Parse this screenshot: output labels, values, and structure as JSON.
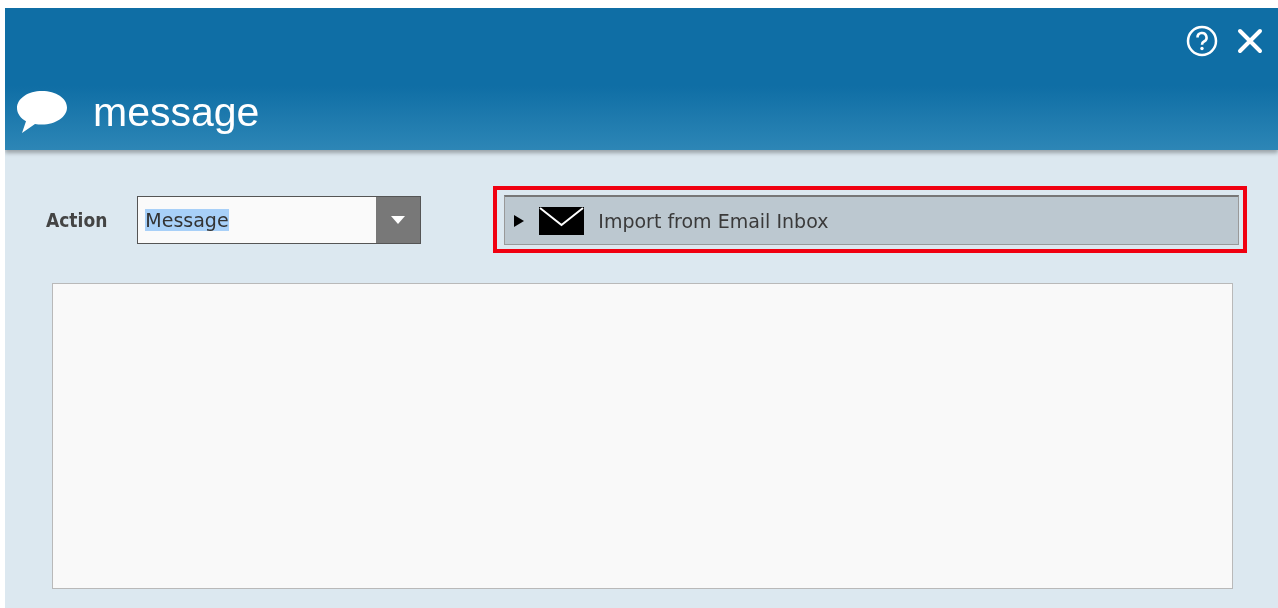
{
  "window": {
    "title": "message"
  },
  "action": {
    "label": "Action",
    "value": "Message",
    "text_selected": true
  },
  "import_panel": {
    "label": "Import from Email Inbox",
    "expanded": false,
    "highlighted": true
  }
}
